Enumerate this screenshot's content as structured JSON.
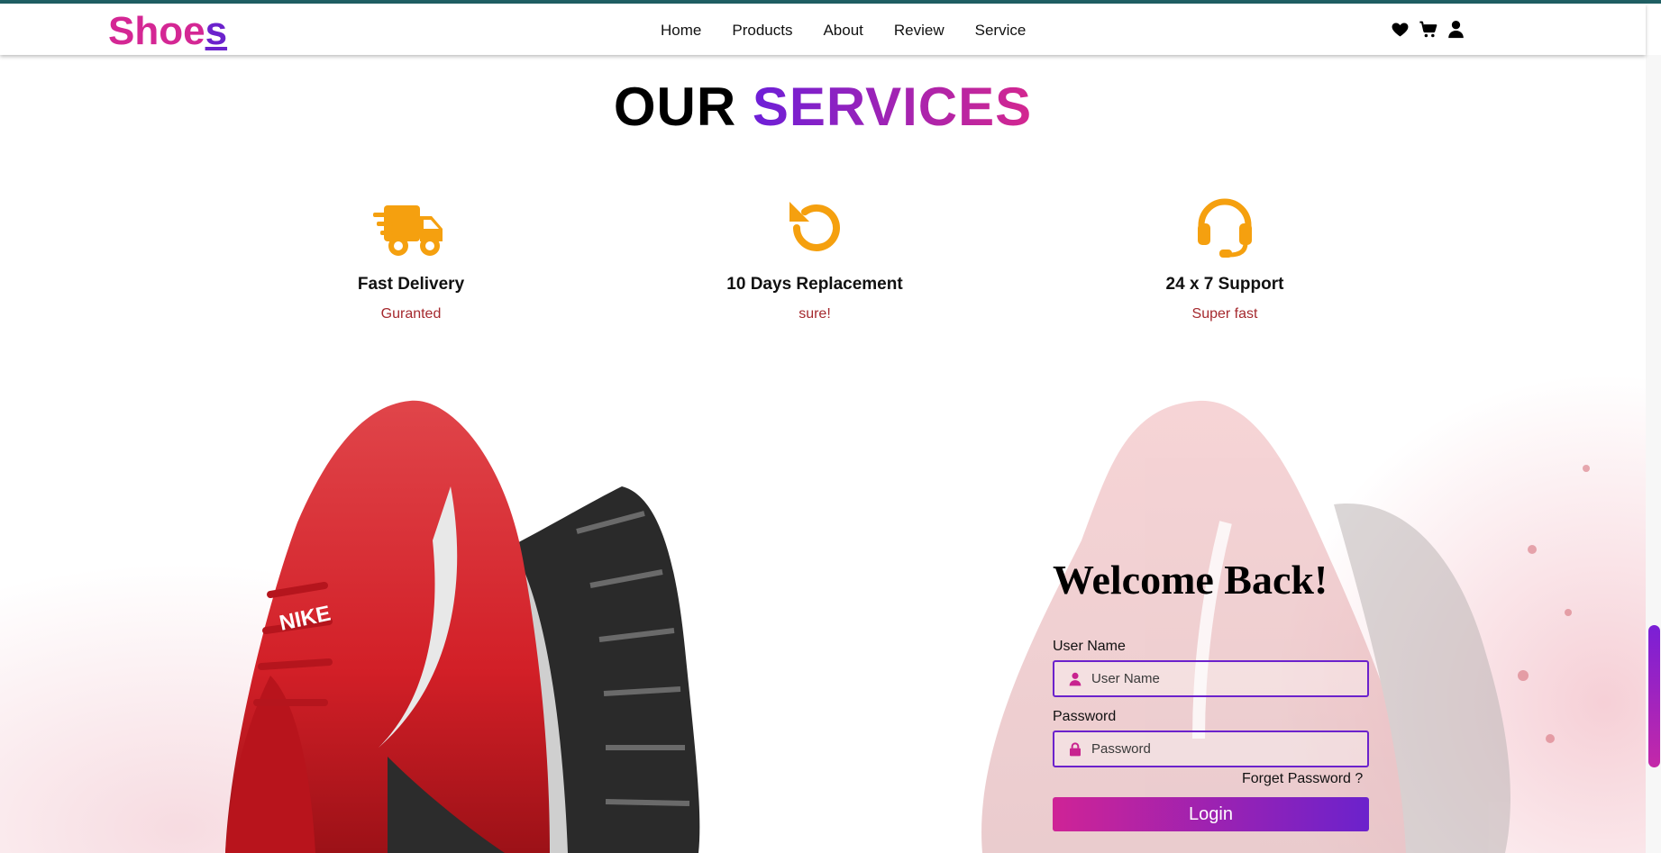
{
  "brand": {
    "logo_main": "Shoe",
    "logo_last": "s"
  },
  "nav": {
    "links": [
      "Home",
      "Products",
      "About",
      "Review",
      "Service"
    ],
    "icons": [
      "heart-icon",
      "cart-icon",
      "user-icon"
    ]
  },
  "services": {
    "title_plain": "OUR",
    "title_accent": "SERVICES",
    "items": [
      {
        "icon": "delivery-truck-icon",
        "title": "Fast Delivery",
        "subtitle": "Guranted"
      },
      {
        "icon": "rotate-icon",
        "title": "10 Days Replacement",
        "subtitle": "sure!"
      },
      {
        "icon": "headset-icon",
        "title": "24 x 7 Support",
        "subtitle": "Super fast"
      }
    ]
  },
  "login": {
    "heading": "Welcome Back!",
    "username_label": "User Name",
    "username_placeholder": "User Name",
    "password_label": "Password",
    "password_placeholder": "Password",
    "forget_link": "Forget Password ?",
    "button_label": "Login"
  },
  "colors": {
    "brand_pink": "#d42794",
    "brand_purple": "#6b22cc",
    "icon_orange": "#f5a00f",
    "subtitle_red": "#a5292e"
  }
}
